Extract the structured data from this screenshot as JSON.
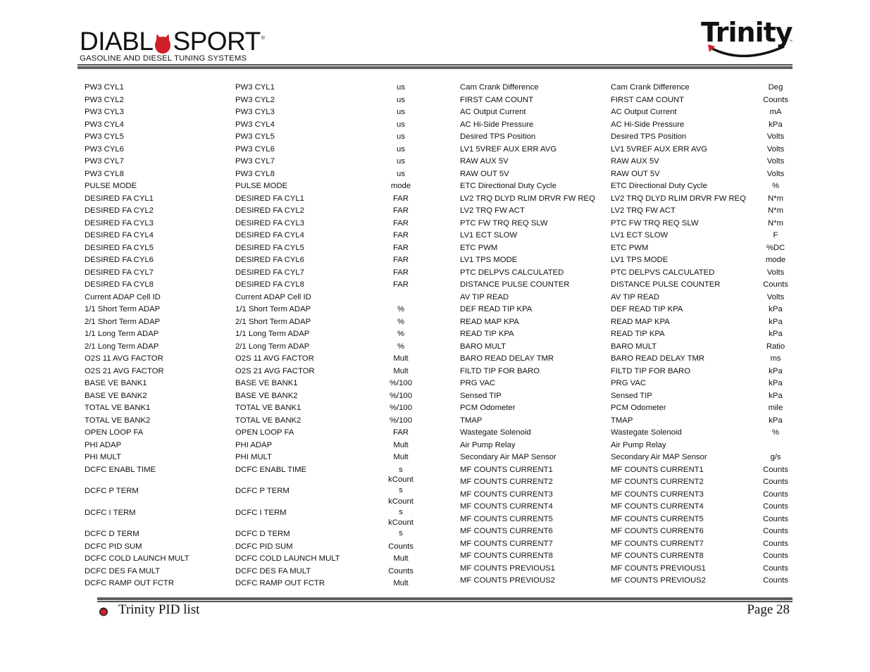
{
  "header": {
    "brand_left_word_prefix": "DIABL",
    "brand_left_word_suffix": "SPORT",
    "brand_left_registered": "®",
    "brand_left_tagline": "GASOLINE AND DIESEL TUNING SYSTEMS",
    "brand_right": "Trinity",
    "brand_right_tm": "™",
    "accent_color": "#d0202a"
  },
  "left_table": [
    {
      "name": "PW3 CYL1",
      "display": "PW3 CYL1",
      "unit": "us"
    },
    {
      "name": "PW3 CYL2",
      "display": "PW3 CYL2",
      "unit": "us"
    },
    {
      "name": "PW3 CYL3",
      "display": "PW3 CYL3",
      "unit": "us"
    },
    {
      "name": "PW3 CYL4",
      "display": "PW3 CYL4",
      "unit": "us"
    },
    {
      "name": "PW3 CYL5",
      "display": "PW3 CYL5",
      "unit": "us"
    },
    {
      "name": "PW3 CYL6",
      "display": "PW3 CYL6",
      "unit": "us"
    },
    {
      "name": "PW3 CYL7",
      "display": "PW3 CYL7",
      "unit": "us"
    },
    {
      "name": "PW3 CYL8",
      "display": "PW3 CYL8",
      "unit": "us"
    },
    {
      "name": "PULSE MODE",
      "display": "PULSE MODE",
      "unit": "mode"
    },
    {
      "name": "DESIRED FA CYL1",
      "display": "DESIRED FA CYL1",
      "unit": "FAR"
    },
    {
      "name": "DESIRED FA CYL2",
      "display": "DESIRED FA CYL2",
      "unit": "FAR"
    },
    {
      "name": "DESIRED FA CYL3",
      "display": "DESIRED FA CYL3",
      "unit": "FAR"
    },
    {
      "name": "DESIRED FA CYL4",
      "display": "DESIRED FA CYL4",
      "unit": "FAR"
    },
    {
      "name": "DESIRED FA CYL5",
      "display": "DESIRED FA CYL5",
      "unit": "FAR"
    },
    {
      "name": "DESIRED FA CYL6",
      "display": "DESIRED FA CYL6",
      "unit": "FAR"
    },
    {
      "name": "DESIRED FA CYL7",
      "display": "DESIRED FA CYL7",
      "unit": "FAR"
    },
    {
      "name": "DESIRED FA CYL8",
      "display": "DESIRED FA CYL8",
      "unit": "FAR"
    },
    {
      "name": "Current ADAP Cell ID",
      "display": "Current ADAP Cell ID",
      "unit": ""
    },
    {
      "name": "1/1 Short Term ADAP",
      "display": "1/1 Short Term ADAP",
      "unit": "%"
    },
    {
      "name": "2/1 Short Term ADAP",
      "display": "2/1 Short Term ADAP",
      "unit": "%"
    },
    {
      "name": "1/1 Long Term ADAP",
      "display": "1/1 Long Term ADAP",
      "unit": "%"
    },
    {
      "name": "2/1 Long Term ADAP",
      "display": "2/1 Long Term ADAP",
      "unit": "%"
    },
    {
      "name": "O2S 11 AVG FACTOR",
      "display": "O2S 11 AVG FACTOR",
      "unit": "Mult"
    },
    {
      "name": "O2S 21 AVG FACTOR",
      "display": "O2S 21 AVG FACTOR",
      "unit": "Mult"
    },
    {
      "name": "BASE VE BANK1",
      "display": "BASE VE BANK1",
      "unit": "%/100"
    },
    {
      "name": "BASE VE BANK2",
      "display": "BASE VE BANK2",
      "unit": "%/100"
    },
    {
      "name": "TOTAL VE BANK1",
      "display": "TOTAL VE BANK1",
      "unit": "%/100"
    },
    {
      "name": "TOTAL VE BANK2",
      "display": "TOTAL VE BANK2",
      "unit": "%/100"
    },
    {
      "name": "OPEN LOOP FA",
      "display": "OPEN LOOP FA",
      "unit": "FAR"
    },
    {
      "name": "PHI ADAP",
      "display": "PHI ADAP",
      "unit": "Mult"
    },
    {
      "name": "PHI MULT",
      "display": "PHI MULT",
      "unit": "Mult"
    },
    {
      "name": "DCFC ENABL TIME",
      "display": "DCFC ENABL TIME",
      "unit": "s"
    },
    {
      "name": "DCFC P TERM",
      "display": "DCFC P TERM",
      "unit_lines": [
        "kCount",
        "s"
      ]
    },
    {
      "name": "DCFC I TERM",
      "display": "DCFC I TERM",
      "unit_lines": [
        "kCount",
        "s"
      ]
    },
    {
      "name": "DCFC D TERM",
      "display": "DCFC D TERM",
      "unit_lines": [
        "kCount",
        "s"
      ]
    },
    {
      "name": "DCFC PID SUM",
      "display": "DCFC PID SUM",
      "unit": "Counts"
    },
    {
      "name": "DCFC COLD LAUNCH MULT",
      "display": "DCFC COLD LAUNCH MULT",
      "unit": "Mult"
    },
    {
      "name": "DCFC DES FA MULT",
      "display": "DCFC DES FA MULT",
      "unit": "Counts"
    },
    {
      "name": "DCFC RAMP OUT FCTR",
      "display": "DCFC RAMP OUT FCTR",
      "unit": "Mult"
    }
  ],
  "right_table": [
    {
      "name": "Cam Crank Difference",
      "display": "Cam Crank Difference",
      "unit": "Deg"
    },
    {
      "name": "FIRST CAM COUNT",
      "display": "FIRST CAM COUNT",
      "unit": "Counts"
    },
    {
      "name": "AC Output Current",
      "display": "AC Output Current",
      "unit": "mA"
    },
    {
      "name": "AC Hi-Side Pressure",
      "display": "AC Hi-Side Pressure",
      "unit": "kPa"
    },
    {
      "name": "Desired TPS Position",
      "display": "Desired TPS Position",
      "unit": "Volts"
    },
    {
      "name": "LV1 5VREF AUX ERR AVG",
      "display": "LV1 5VREF AUX ERR AVG",
      "unit": "Volts"
    },
    {
      "name": "RAW AUX 5V",
      "display": "RAW AUX 5V",
      "unit": "Volts"
    },
    {
      "name": "RAW OUT 5V",
      "display": "RAW OUT 5V",
      "unit": "Volts"
    },
    {
      "name": "ETC Directional Duty Cycle",
      "display": "ETC Directional Duty Cycle",
      "unit": "%"
    },
    {
      "name": "LV2 TRQ DLYD RLIM DRVR FW REQ",
      "display": "LV2 TRQ DLYD RLIM DRVR FW REQ",
      "unit": "N*m"
    },
    {
      "name": "LV2 TRQ FW ACT",
      "display": "LV2 TRQ FW ACT",
      "unit": "N*m"
    },
    {
      "name": "PTC FW TRQ REQ SLW",
      "display": "PTC FW TRQ REQ SLW",
      "unit": "N*m"
    },
    {
      "name": "LV1 ECT SLOW",
      "display": "LV1 ECT SLOW",
      "unit": "F"
    },
    {
      "name": "ETC PWM",
      "display": "ETC PWM",
      "unit": "%DC"
    },
    {
      "name": "LV1 TPS MODE",
      "display": "LV1 TPS MODE",
      "unit": "mode"
    },
    {
      "name": "PTC DELPVS CALCULATED",
      "display": "PTC DELPVS CALCULATED",
      "unit": "Volts"
    },
    {
      "name": "DISTANCE PULSE COUNTER",
      "display": "DISTANCE PULSE COUNTER",
      "unit": "Counts"
    },
    {
      "name": "AV TIP READ",
      "display": "AV TIP READ",
      "unit": "Volts"
    },
    {
      "name": "DEF READ TIP KPA",
      "display": "DEF READ TIP KPA",
      "unit": "kPa"
    },
    {
      "name": "READ MAP KPA",
      "display": "READ MAP KPA",
      "unit": "kPa"
    },
    {
      "name": "READ TIP KPA",
      "display": "READ TIP KPA",
      "unit": "kPa"
    },
    {
      "name": "BARO MULT",
      "display": "BARO MULT",
      "unit": "Ratio"
    },
    {
      "name": "BARO READ DELAY TMR",
      "display": "BARO READ DELAY TMR",
      "unit": "ms"
    },
    {
      "name": "FILTD TIP FOR BARO",
      "display": "FILTD TIP FOR BARO",
      "unit": "kPa"
    },
    {
      "name": "PRG VAC",
      "display": "PRG VAC",
      "unit": "kPa"
    },
    {
      "name": "Sensed TIP",
      "display": "Sensed TIP",
      "unit": "kPa"
    },
    {
      "name": "PCM Odometer",
      "display": "PCM Odometer",
      "unit": "mile"
    },
    {
      "name": "TMAP",
      "display": "TMAP",
      "unit": "kPa"
    },
    {
      "name": "Wastegate Solenoid",
      "display": "Wastegate Solenoid",
      "unit": "%"
    },
    {
      "name": "Air Pump Relay",
      "display": "Air Pump Relay",
      "unit": ""
    },
    {
      "name": "Secondary Air MAP Sensor",
      "display": "Secondary Air MAP Sensor",
      "unit": "g/s"
    },
    {
      "name": "MF COUNTS CURRENT1",
      "display": "MF COUNTS CURRENT1",
      "unit": "Counts"
    },
    {
      "name": "MF COUNTS CURRENT2",
      "display": "MF COUNTS CURRENT2",
      "unit": "Counts"
    },
    {
      "name": "MF COUNTS CURRENT3",
      "display": "MF COUNTS CURRENT3",
      "unit": "Counts"
    },
    {
      "name": "MF COUNTS CURRENT4",
      "display": "MF COUNTS CURRENT4",
      "unit": "Counts"
    },
    {
      "name": "MF COUNTS CURRENT5",
      "display": "MF COUNTS CURRENT5",
      "unit": "Counts"
    },
    {
      "name": "MF COUNTS CURRENT6",
      "display": "MF COUNTS CURRENT6",
      "unit": "Counts"
    },
    {
      "name": "MF COUNTS CURRENT7",
      "display": "MF COUNTS CURRENT7",
      "unit": "Counts"
    },
    {
      "name": "MF COUNTS CURRENT8",
      "display": "MF COUNTS CURRENT8",
      "unit": "Counts"
    },
    {
      "name": "MF COUNTS PREVIOUS1",
      "display": "MF COUNTS PREVIOUS1",
      "unit": "Counts"
    },
    {
      "name": "MF COUNTS PREVIOUS2",
      "display": "MF COUNTS PREVIOUS2",
      "unit": "Counts"
    }
  ],
  "footer": {
    "title": "Trinity PID list",
    "page_label": "Page 28",
    "icon": "diablo-devil-icon"
  }
}
